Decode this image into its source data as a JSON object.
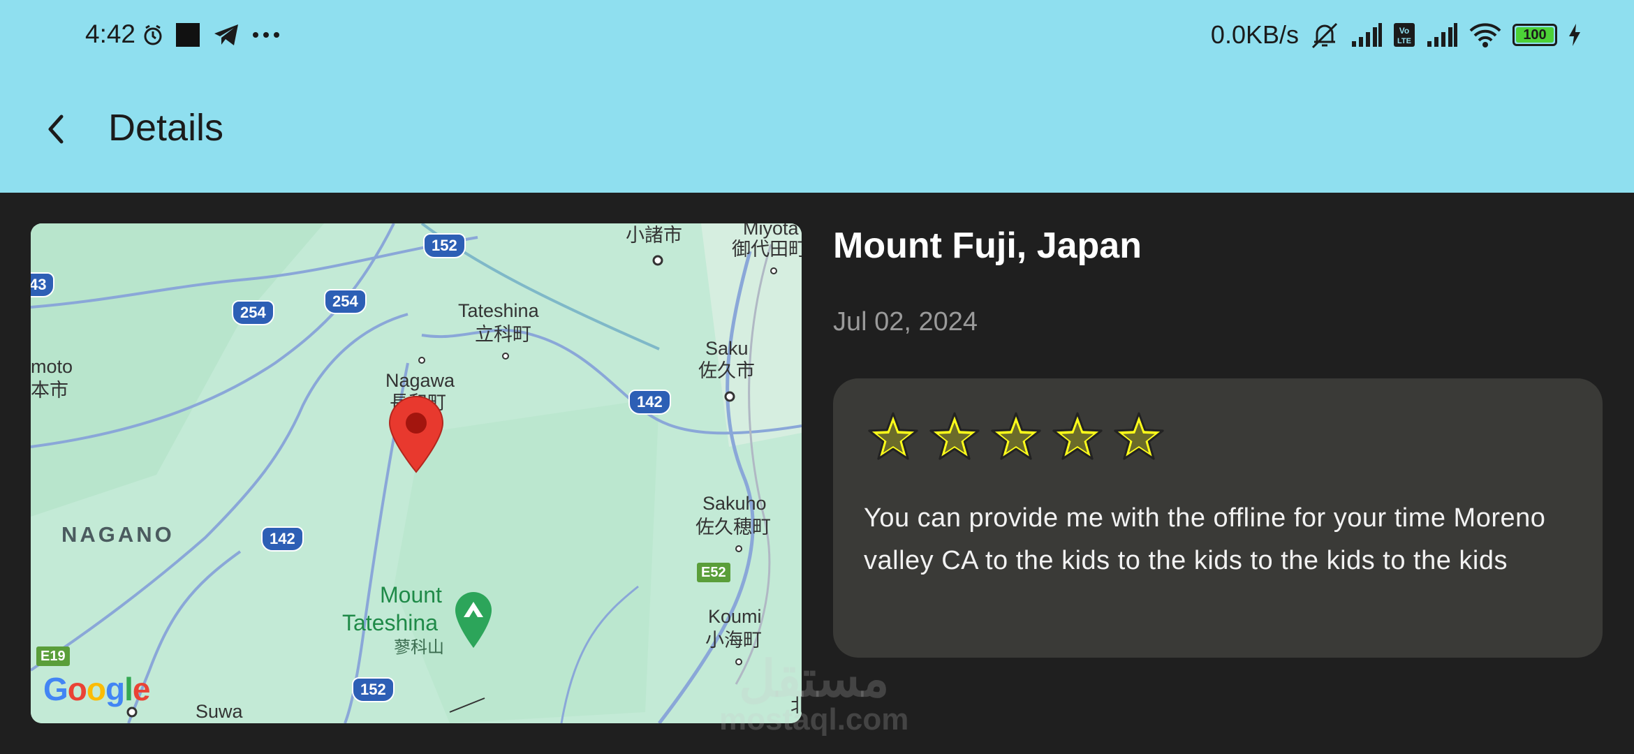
{
  "status_bar": {
    "time": "4:42",
    "network_speed": "0.0KB/s",
    "battery_level": "100",
    "battery_percent": 100,
    "left_icons": [
      "alarm-icon",
      "notification-square-icon",
      "telegram-icon",
      "more-dots-icon"
    ],
    "right_icons": [
      "mute-icon",
      "signal-icon",
      "volte-icon",
      "signal-icon",
      "wifi-icon",
      "battery-icon",
      "charging-icon"
    ]
  },
  "app_bar": {
    "title": "Details",
    "back_icon": "chevron-left-icon",
    "background": "#8fdfef"
  },
  "map": {
    "labels": {
      "komoro": "小諸市",
      "miyota_en": "Miyota",
      "miyota_jp": "御代田町",
      "tateshina_en": "Tateshina",
      "tateshina_jp": "立科町",
      "saku_en": "Saku",
      "saku_jp": "佐久市",
      "moto_en": "moto",
      "moto_jp": "本市",
      "nagawa_en": "Nagawa",
      "nagawa_jp": "長和町",
      "nagano": "NAGANO",
      "sakuho_en": "Sakuho",
      "sakuho_jp": "佐久穂町",
      "mount_tateshina_1": "Mount",
      "mount_tateshina_2": "Tateshina",
      "mount_tateshina_jp": "蓼科山",
      "koumi_en": "Koumi",
      "koumi_jp": "小海町",
      "suwa": "Suwa",
      "north_jp": "北"
    },
    "shields": {
      "r152_top": "152",
      "r254_a": "254",
      "r254_b": "254",
      "r142_a": "142",
      "r142_b": "142",
      "r152_bottom": "152",
      "r43": "43",
      "e52": "E52",
      "e19": "E19"
    },
    "google_logo": "Google",
    "pin_icon": "map-pin-icon",
    "park_icon": "mountain-park-icon"
  },
  "place": {
    "title": "Mount Fuji, Japan",
    "date": "Jul 02, 2024"
  },
  "review": {
    "rating": 5,
    "max_rating": 5,
    "star_fill_color": "#ffff1a",
    "text": "You can provide me with the offline for your time Moreno valley CA to the kids to the kids to the kids to the kids"
  },
  "watermark": {
    "arabic": "مستقل",
    "url": "mostaql.com"
  }
}
